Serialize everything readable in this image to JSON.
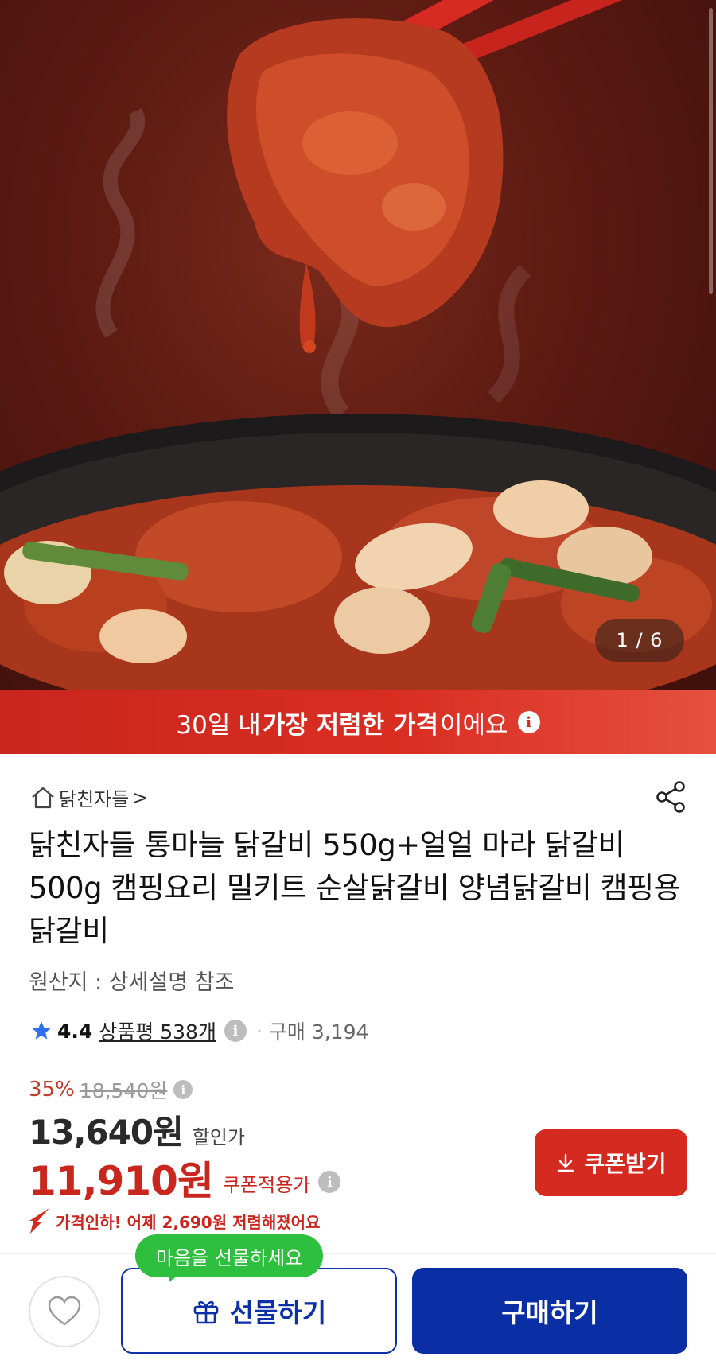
{
  "gallery": {
    "counter": "1 / 6",
    "image_description_icon": "food-photo"
  },
  "banner": {
    "pre": "30일 내 ",
    "bold": "가장 저렴한 가격",
    "post": "이에요",
    "info_icon": "i"
  },
  "store": {
    "name": "닭친자들",
    "chevron": ">"
  },
  "product": {
    "title": "닭친자들 통마늘 닭갈비 550g+얼얼 마라 닭갈비 500g 캠핑요리 밀키트 순살닭갈비 양념닭갈비 캠핑용 닭갈비",
    "origin": "원산지 : 상세설명 참조"
  },
  "rating": {
    "score": "4.4",
    "reviews": "상품평 538개",
    "info_icon": "i",
    "dot": "·",
    "purchases": "구매 3,194"
  },
  "price": {
    "discount_pct": "35%",
    "original": "18,540원",
    "sale_value": "13,640원",
    "sale_label": "할인가",
    "coupon_value": "11,910원",
    "coupon_label": "쿠폰적용가",
    "price_drop": "가격인하! 어제 2,690원 저렴해졌어요"
  },
  "buttons": {
    "coupon": "쿠폰받기",
    "gift": "선물하기",
    "buy": "구매하기",
    "gift_tooltip": "마음을 선물하세요"
  },
  "colors": {
    "brand_red": "#d42a20",
    "brand_blue": "#0a2ea3",
    "tooltip_green": "#2fbf3e"
  }
}
